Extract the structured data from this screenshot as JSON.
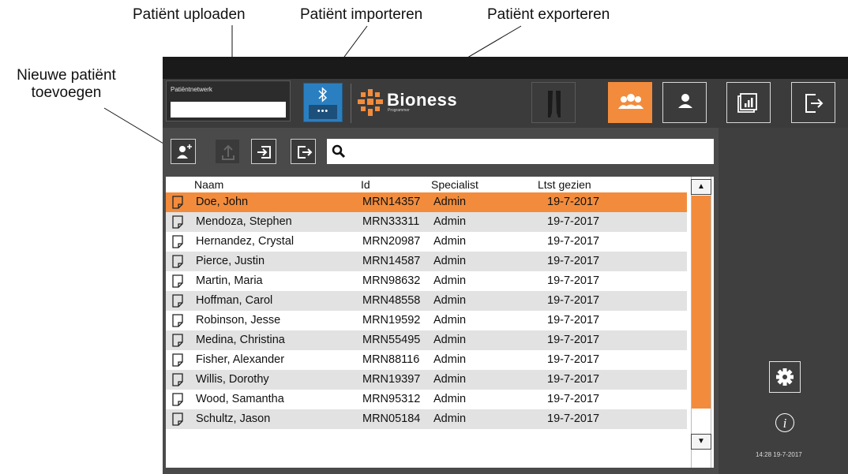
{
  "callouts": {
    "upload": "Patiënt uploaden",
    "import": "Patiënt importeren",
    "export": "Patiënt exporteren",
    "new_line1": "Nieuwe patiënt",
    "new_line2": "toevoegen"
  },
  "header": {
    "network_label": "Patiëntnetwerk",
    "network_value": "",
    "bluetooth_icon": "bluetooth-icon",
    "bluetooth_dots": "•••",
    "brand": "Bioness",
    "brand_sub": "Programmer",
    "nav_buttons": [
      "legs-icon",
      "patients-group-icon",
      "user-icon",
      "reports-icon",
      "exit-icon"
    ],
    "active_nav": "patients-group-icon"
  },
  "toolbar": {
    "icons": [
      "add-patient-icon",
      "upload-icon",
      "import-icon",
      "export-icon"
    ],
    "search_icon": "search-icon",
    "search_value": ""
  },
  "table": {
    "columns": [
      "Naam",
      "Id",
      "Specialist",
      "Ltst gezien"
    ],
    "selected_index": 0,
    "rows": [
      {
        "name": "Doe, John",
        "id": "MRN14357",
        "specialist": "Admin",
        "last_seen": "19-7-2017"
      },
      {
        "name": "Mendoza, Stephen",
        "id": "MRN33311",
        "specialist": "Admin",
        "last_seen": "19-7-2017"
      },
      {
        "name": "Hernandez, Crystal",
        "id": "MRN20987",
        "specialist": "Admin",
        "last_seen": "19-7-2017"
      },
      {
        "name": "Pierce, Justin",
        "id": "MRN14587",
        "specialist": "Admin",
        "last_seen": "19-7-2017"
      },
      {
        "name": "Martin, Maria",
        "id": "MRN98632",
        "specialist": "Admin",
        "last_seen": "19-7-2017"
      },
      {
        "name": "Hoffman, Carol",
        "id": "MRN48558",
        "specialist": "Admin",
        "last_seen": "19-7-2017"
      },
      {
        "name": "Robinson, Jesse",
        "id": "MRN19592",
        "specialist": "Admin",
        "last_seen": "19-7-2017"
      },
      {
        "name": "Medina, Christina",
        "id": "MRN55495",
        "specialist": "Admin",
        "last_seen": "19-7-2017"
      },
      {
        "name": "Fisher, Alexander",
        "id": "MRN88116",
        "specialist": "Admin",
        "last_seen": "19-7-2017"
      },
      {
        "name": "Willis, Dorothy",
        "id": "MRN19397",
        "specialist": "Admin",
        "last_seen": "19-7-2017"
      },
      {
        "name": "Wood, Samantha",
        "id": "MRN95312",
        "specialist": "Admin",
        "last_seen": "19-7-2017"
      },
      {
        "name": "Schultz, Jason",
        "id": "MRN05184",
        "specialist": "Admin",
        "last_seen": "19-7-2017"
      }
    ],
    "scroll_up": "▲",
    "scroll_down": "▼"
  },
  "sidebar": {
    "settings_icon": "gear-icon",
    "info_glyph": "i",
    "clock": "14:28 19-7-2017"
  },
  "colors": {
    "accent": "#f28c3c",
    "header_bg": "#3b3b3b",
    "bluetooth": "#2a7fc0"
  }
}
